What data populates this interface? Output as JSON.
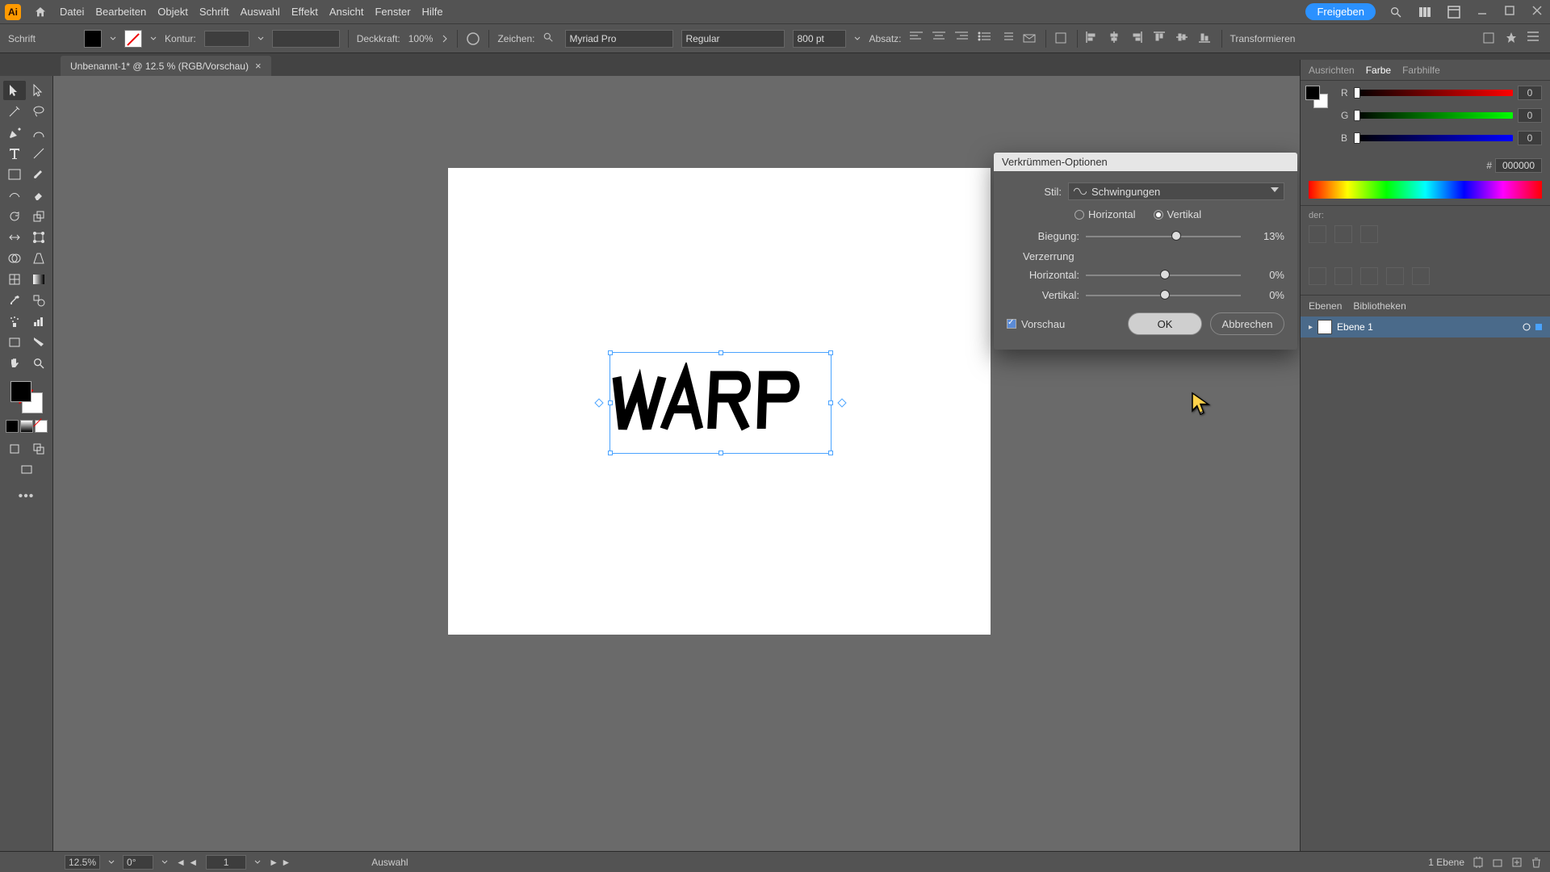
{
  "menubar": {
    "app_initials": "Ai",
    "items": [
      "Datei",
      "Bearbeiten",
      "Objekt",
      "Schrift",
      "Auswahl",
      "Effekt",
      "Ansicht",
      "Fenster",
      "Hilfe"
    ],
    "share": "Freigeben"
  },
  "controlbar": {
    "left_label": "Schrift",
    "kontur": "Kontur:",
    "deckkraft_label": "Deckkraft:",
    "deckkraft_value": "100%",
    "zeichen_label": "Zeichen:",
    "font_family": "Myriad Pro",
    "font_style": "Regular",
    "font_size": "800 pt",
    "absatz": "Absatz:",
    "transformieren": "Transformieren"
  },
  "tab": {
    "title": "Unbenannt-1* @ 12.5 % (RGB/Vorschau)",
    "close": "×"
  },
  "canvas": {
    "text": "WARP"
  },
  "dialog": {
    "title": "Verkrümmen-Optionen",
    "stil_label": "Stil:",
    "stil_value": "Schwingungen",
    "horiz": "Horizontal",
    "vert": "Vertikal",
    "biegung_label": "Biegung:",
    "biegung_value": "13%",
    "verzerrung": "Verzerrung",
    "horiz_label": "Horizontal:",
    "horiz_value": "0%",
    "vert_label": "Vertikal:",
    "vert_value": "0%",
    "vorschau": "Vorschau",
    "ok": "OK",
    "cancel": "Abbrechen"
  },
  "right": {
    "tabs": {
      "ausrichten": "Ausrichten",
      "farbe": "Farbe",
      "farbhilfe": "Farbhilfe"
    },
    "rgb": {
      "r": "R",
      "g": "G",
      "b": "B",
      "r_val": "0",
      "g_val": "0",
      "b_val": "0"
    },
    "hex": "000000",
    "sections": {
      "prop_title": "der:",
      "libs": "Bibliotheken"
    },
    "layers_tab": "Ebenen",
    "layer_name": "Ebene 1"
  },
  "status": {
    "zoom": "12.5%",
    "rotation": "0°",
    "artboard_nav": "1",
    "tool": "Auswahl",
    "layer_count": "1 Ebene"
  }
}
